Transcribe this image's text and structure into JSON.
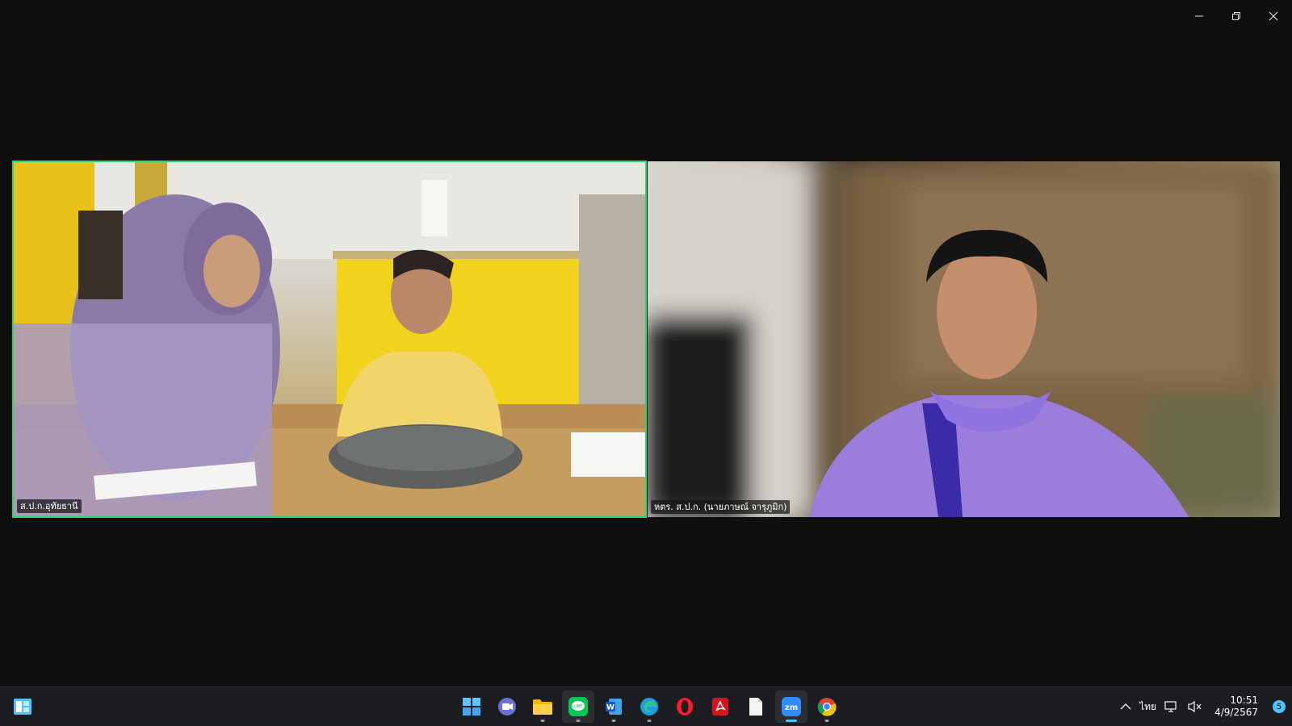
{
  "window": {
    "controls": {
      "minimize": "minimize",
      "restore": "restore",
      "close": "close"
    }
  },
  "participants": [
    {
      "name": "ส.ป.ก.อุทัยธานี",
      "active_speaker": true
    },
    {
      "name": "หตร. ส.ป.ก. (นายภาษณ์  จารุภูมิก)",
      "active_speaker": false
    }
  ],
  "taskbar": {
    "apps": [
      {
        "name": "Start",
        "icon": "windows-start-icon",
        "running": false
      },
      {
        "name": "Teams Chat",
        "icon": "teams-chat-icon",
        "running": false
      },
      {
        "name": "File Explorer",
        "icon": "folder-icon",
        "running": true
      },
      {
        "name": "LINE",
        "icon": "line-icon",
        "running": true
      },
      {
        "name": "Word",
        "icon": "word-icon",
        "running": true
      },
      {
        "name": "Edge",
        "icon": "edge-icon",
        "running": true
      },
      {
        "name": "Opera",
        "icon": "opera-icon",
        "running": false
      },
      {
        "name": "Acrobat",
        "icon": "acrobat-icon",
        "running": false
      },
      {
        "name": "Notepad",
        "icon": "file-icon",
        "running": false
      },
      {
        "name": "Zoom",
        "icon": "zoom-icon",
        "running": true
      },
      {
        "name": "Chrome",
        "icon": "chrome-icon",
        "running": true
      }
    ],
    "tray": {
      "language": "ไทย",
      "time": "10:51",
      "date": "4/9/2567",
      "notifications": "5"
    }
  },
  "colors": {
    "background": "#0f0f0f",
    "active_border": "#2ed573",
    "taskbar": "#1c1d20",
    "accent": "#4cc2ff"
  }
}
